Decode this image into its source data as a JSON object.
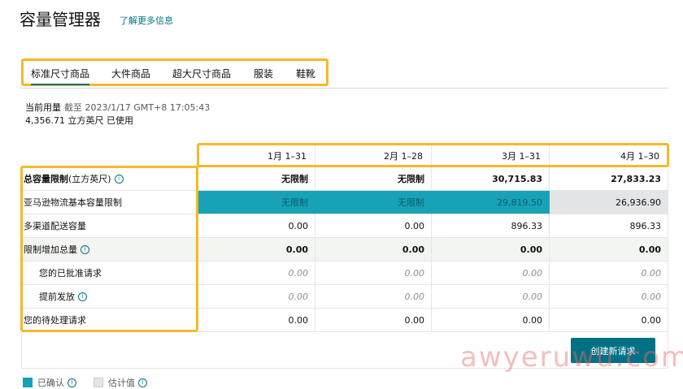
{
  "header": {
    "title": "容量管理器",
    "learn_more": "了解更多信息"
  },
  "tabs": [
    "标准尺寸商品",
    "大件商品",
    "超大尺寸商品",
    "服装",
    "鞋靴"
  ],
  "usage": {
    "label": "当前用量",
    "as_of": "截至 2023/1/17 GMT+8 17:05:43",
    "value": "4,356.71 立方英尺 已使用"
  },
  "table": {
    "columns": [
      "1月 1–31",
      "2月 1–28",
      "3月 1–31",
      "4月 1–30"
    ],
    "rows": [
      {
        "label": "总容量限制",
        "label_suffix": " (立方英尺)",
        "cells": [
          "无限制",
          "无限制",
          "30,715.83",
          "27,833.23"
        ]
      },
      {
        "label": "亚马逊物流基本容量限制",
        "cells": [
          "无限制",
          "无限制",
          "29,819.50",
          "26,936.90"
        ]
      },
      {
        "label": "多渠道配送容量",
        "cells": [
          "0.00",
          "0.00",
          "896.33",
          "896.33"
        ]
      },
      {
        "label": "限制增加总量",
        "cells": [
          "0.00",
          "0.00",
          "0.00",
          "0.00"
        ]
      },
      {
        "label": "您的已批准请求",
        "cells": [
          "0.00",
          "0.00",
          "0.00",
          "0.00"
        ]
      },
      {
        "label": "提前发放",
        "cells": [
          "0.00",
          "0.00",
          "0.00",
          "0.00"
        ]
      },
      {
        "label": "您的待处理请求",
        "cells": [
          "0.00",
          "0.00",
          "0.00",
          "0.00"
        ]
      }
    ]
  },
  "create_button": "创建新请求",
  "legend": {
    "confirmed": "已确认",
    "estimated": "估计值"
  },
  "watermark": "awyeruwu.com",
  "colors": {
    "accent": "#007185",
    "confirmed": "#17a2b8",
    "estimated": "#e3e6e6",
    "highlight_outline": "#f6b82b"
  }
}
